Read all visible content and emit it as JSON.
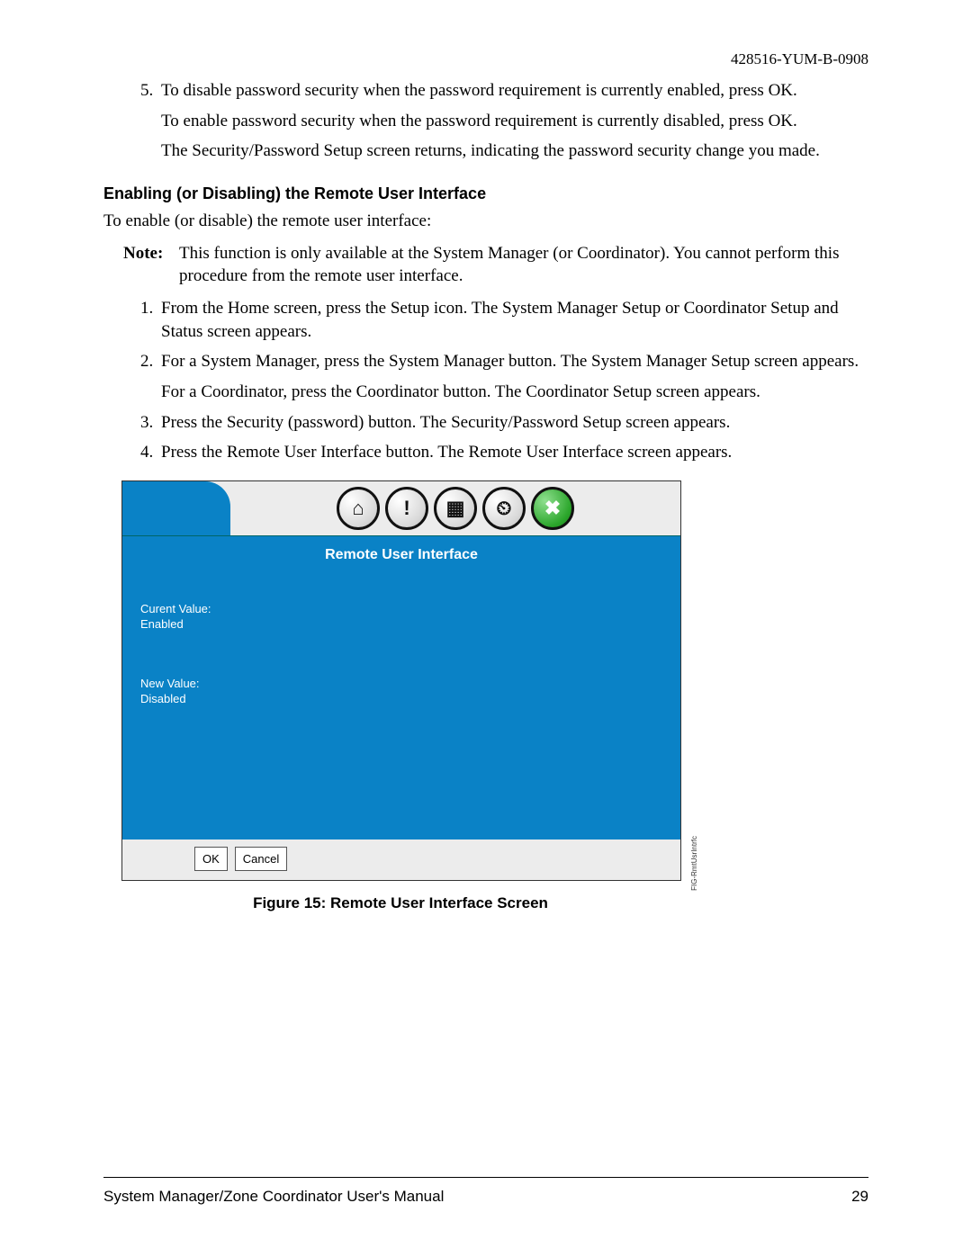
{
  "doc_id": "428516-YUM-B-0908",
  "step5": {
    "a": "To disable password security when the password requirement is currently enabled, press OK.",
    "b": "To enable password security when the password requirement is currently disabled, press OK.",
    "c": "The Security/Password Setup screen returns, indicating the password security change you made."
  },
  "section_heading": "Enabling (or Disabling) the Remote User Interface",
  "intro": "To enable (or disable) the remote user interface:",
  "note": {
    "label": "Note:",
    "text": "This function is only available at the System Manager (or Coordinator). You cannot perform this procedure from the remote user interface."
  },
  "steps": {
    "s1": "From the Home screen, press the Setup icon. The System Manager Setup or Coordinator Setup and Status screen appears.",
    "s2a": "For a System Manager, press the System Manager button. The System Manager Setup screen appears.",
    "s2b": "For a Coordinator, press the Coordinator button. The Coordinator Setup screen appears.",
    "s3": "Press the Security (password) button. The Security/Password Setup screen appears.",
    "s4": "Press the Remote User Interface button. The Remote User Interface screen appears."
  },
  "figure": {
    "title": "Remote User Interface",
    "current_label": "Curent Value:",
    "current_value": "Enabled",
    "new_label": "New Value:",
    "new_value": "Disabled",
    "ok": "OK",
    "cancel": "Cancel",
    "side": "FIG-RmtUsrIntrfc",
    "caption": "Figure 15: Remote User Interface Screen",
    "icons": {
      "home": "⌂",
      "alert": "!",
      "grid": "▦",
      "clock": "⏲",
      "tools": "✖"
    }
  },
  "footer": {
    "left": "System Manager/Zone Coordinator User's Manual",
    "right": "29"
  }
}
